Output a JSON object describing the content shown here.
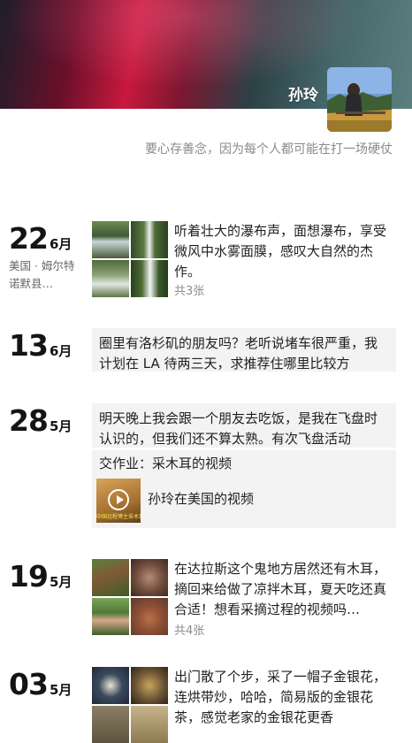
{
  "profile": {
    "name": "孙玲",
    "signature": "要心存善念，因为每个人都可能在打一场硬仗"
  },
  "posts": [
    {
      "day": "22",
      "month": "6月",
      "location": "美国 · 姆尔特诺默县…",
      "text": "听着壮大的瀑布声，面想瀑布，享受微风中水雾面膜，感叹大自然的杰作。",
      "count": "共3张"
    },
    {
      "day": "13",
      "month": "6月",
      "text": "圈里有洛杉矶的朋友吗？老听说堵车很严重，我计划在 LA 待两三天，求推荐住哪里比较方"
    },
    {
      "day": "28",
      "month": "5月",
      "text": "明天晚上我会跟一个朋友去吃饭，是我在飞盘时认识的，但我们还不算太熟。有次飞盘活动",
      "video": {
        "title": "交作业：采木耳的视频",
        "label": "孙玲在美国的视频",
        "thumb_caption": "中国远程博主采木耳"
      }
    },
    {
      "day": "19",
      "month": "5月",
      "text": "在达拉斯这个鬼地方居然还有木耳，摘回来给做了凉拌木耳，夏天吃还真合适！想看采摘过程的视频吗…",
      "count": "共4张"
    },
    {
      "day": "03",
      "month": "5月",
      "text": "出门散了个步，采了一帽子金银花，连烘带炒，哈哈，简易版的金银花茶，感觉老家的金银花更香"
    }
  ],
  "colors": {
    "cover_red": "#c8193d",
    "cover_teal": "#46686b",
    "secondary_text": "#8a8a8a",
    "box_bg": "#f3f3f3"
  }
}
